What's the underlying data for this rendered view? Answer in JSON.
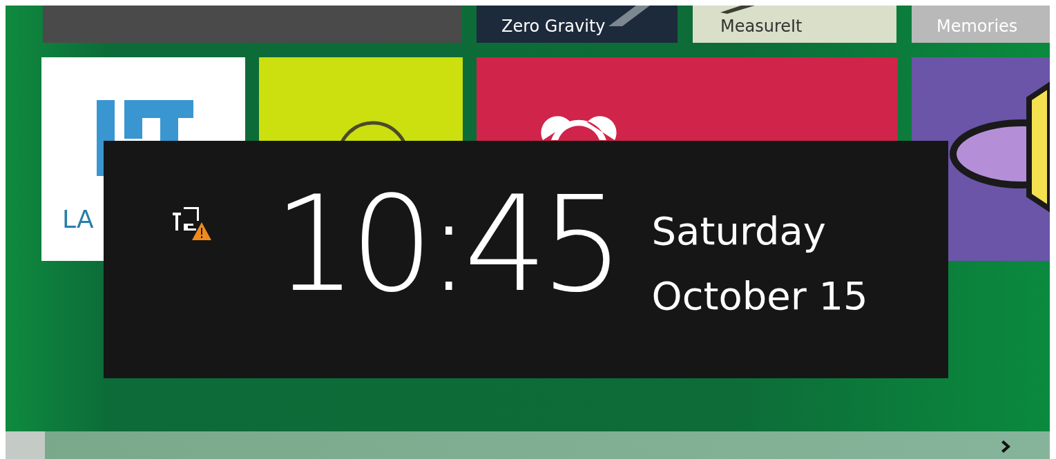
{
  "tile_rows": [
    [
      {
        "kind": "plain",
        "color": "#4a4a4a"
      },
      {
        "kind": "photo",
        "label": "Zero Gravity",
        "color": "#1d2a3c"
      },
      {
        "kind": "photo-light",
        "label": "MeasureIt",
        "color": "#d9dfc9"
      },
      {
        "kind": "faded",
        "label": "Memories",
        "color": "#b9b9b9"
      }
    ],
    [
      {
        "kind": "square-logo",
        "label": "LA",
        "color": "#ffffff"
      },
      {
        "kind": "circle-logo",
        "color": "#cbe00e"
      },
      {
        "kind": "alarm",
        "color": "#d0244a"
      },
      {
        "kind": "cartoon",
        "color": "#6a55a8"
      }
    ]
  ],
  "lock_overlay": {
    "network_warning": true,
    "time": "10:45",
    "day": "Saturday",
    "date": "October 15"
  }
}
